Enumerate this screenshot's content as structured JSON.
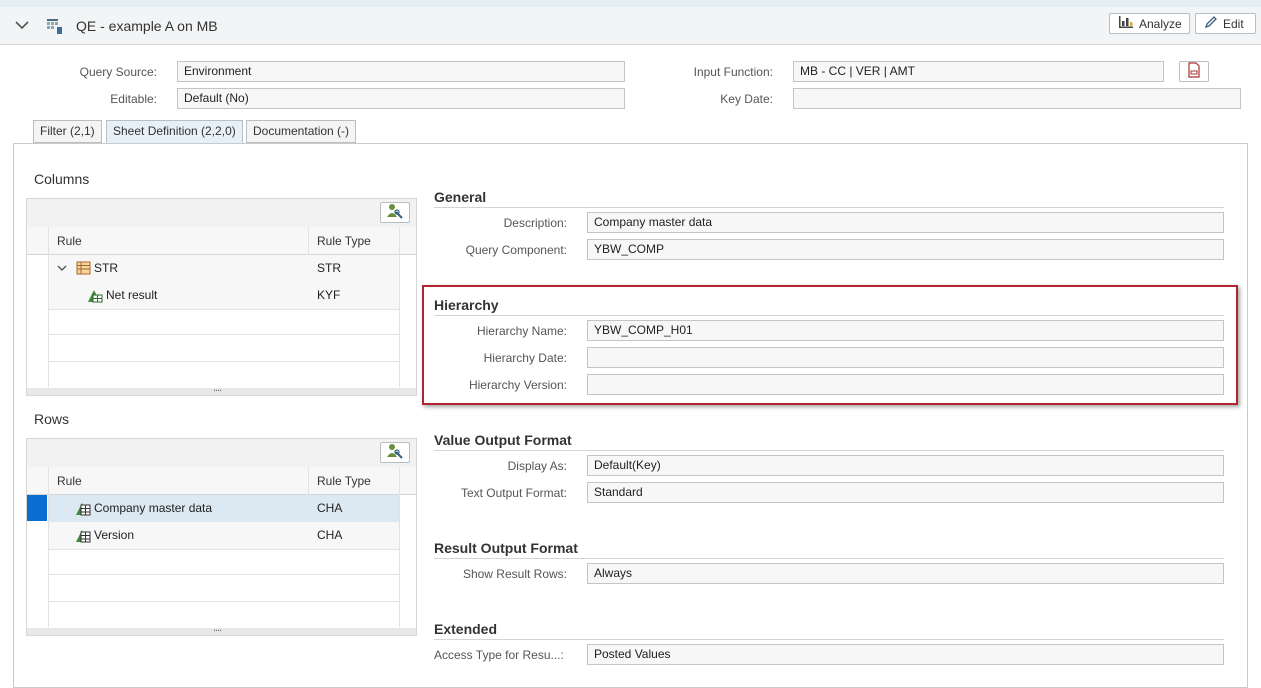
{
  "header": {
    "title": "QE - example A on MB",
    "analyze_label": "Analyze",
    "edit_label": "Edit"
  },
  "meta": {
    "query_source_label": "Query Source:",
    "query_source_value": "Environment",
    "editable_label": "Editable:",
    "editable_value": "Default (No)",
    "input_function_label": "Input Function:",
    "input_function_value": "MB - CC | VER | AMT",
    "key_date_label": "Key Date:",
    "key_date_value": ""
  },
  "tabs": [
    {
      "label": "Filter (2,1)",
      "active": false
    },
    {
      "label": "Sheet Definition (2,2,0)",
      "active": true
    },
    {
      "label": "Documentation (-)",
      "active": false
    }
  ],
  "columns": {
    "title": "Columns",
    "header_rule": "Rule",
    "header_type": "Rule Type",
    "rows": [
      {
        "rule": "STR",
        "type": "STR"
      },
      {
        "rule": "Net result",
        "type": "KYF"
      }
    ],
    "resize_handle": "...."
  },
  "rows_section": {
    "title": "Rows",
    "header_rule": "Rule",
    "header_type": "Rule Type",
    "rows": [
      {
        "rule": "Company master data",
        "type": "CHA",
        "selected": true
      },
      {
        "rule": "Version",
        "type": "CHA",
        "selected": false
      }
    ],
    "resize_handle": "...."
  },
  "general": {
    "title": "General",
    "description_label": "Description:",
    "description_value": "Company master data",
    "query_component_label": "Query Component:",
    "query_component_value": "YBW_COMP"
  },
  "hierarchy": {
    "title": "Hierarchy",
    "name_label": "Hierarchy Name:",
    "name_value": "YBW_COMP_H01",
    "date_label": "Hierarchy Date:",
    "date_value": "",
    "version_label": "Hierarchy Version:",
    "version_value": ""
  },
  "value_output": {
    "title": "Value Output Format",
    "display_as_label": "Display As:",
    "display_as_value": "Default(Key)",
    "text_output_label": "Text Output Format:",
    "text_output_value": "Standard"
  },
  "result_output": {
    "title": "Result Output Format",
    "show_rows_label": "Show Result Rows:",
    "show_rows_value": "Always"
  },
  "extended": {
    "title": "Extended",
    "access_type_label": "Access Type for Resu...:",
    "access_type_value": "Posted Values"
  },
  "colors": {
    "highlight_border": "#b0262e",
    "selected_row": "#dce9f2",
    "selected_marker": "#0a6ed1"
  }
}
